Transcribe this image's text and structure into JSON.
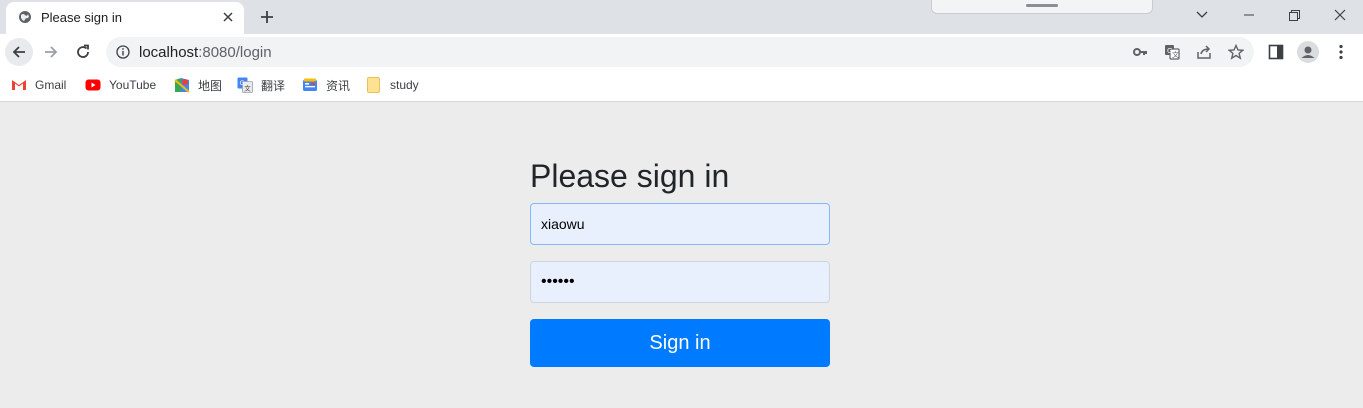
{
  "browser": {
    "tab": {
      "title": "Please sign in"
    },
    "url": {
      "host": "localhost",
      "path": ":8080/login"
    },
    "bookmarks": [
      {
        "label": "Gmail",
        "icon": "gmail-icon"
      },
      {
        "label": "YouTube",
        "icon": "youtube-icon"
      },
      {
        "label": "地图",
        "icon": "maps-icon"
      },
      {
        "label": "翻译",
        "icon": "translate-icon"
      },
      {
        "label": "资讯",
        "icon": "news-icon"
      },
      {
        "label": "study",
        "icon": "folder-icon"
      }
    ]
  },
  "login": {
    "heading": "Please sign in",
    "username": "xiaowu",
    "password": "••••••",
    "submit_label": "Sign in"
  },
  "colors": {
    "primary_button": "#007bff",
    "autofill_bg": "#e8f0fe",
    "page_bg": "#ececec"
  }
}
